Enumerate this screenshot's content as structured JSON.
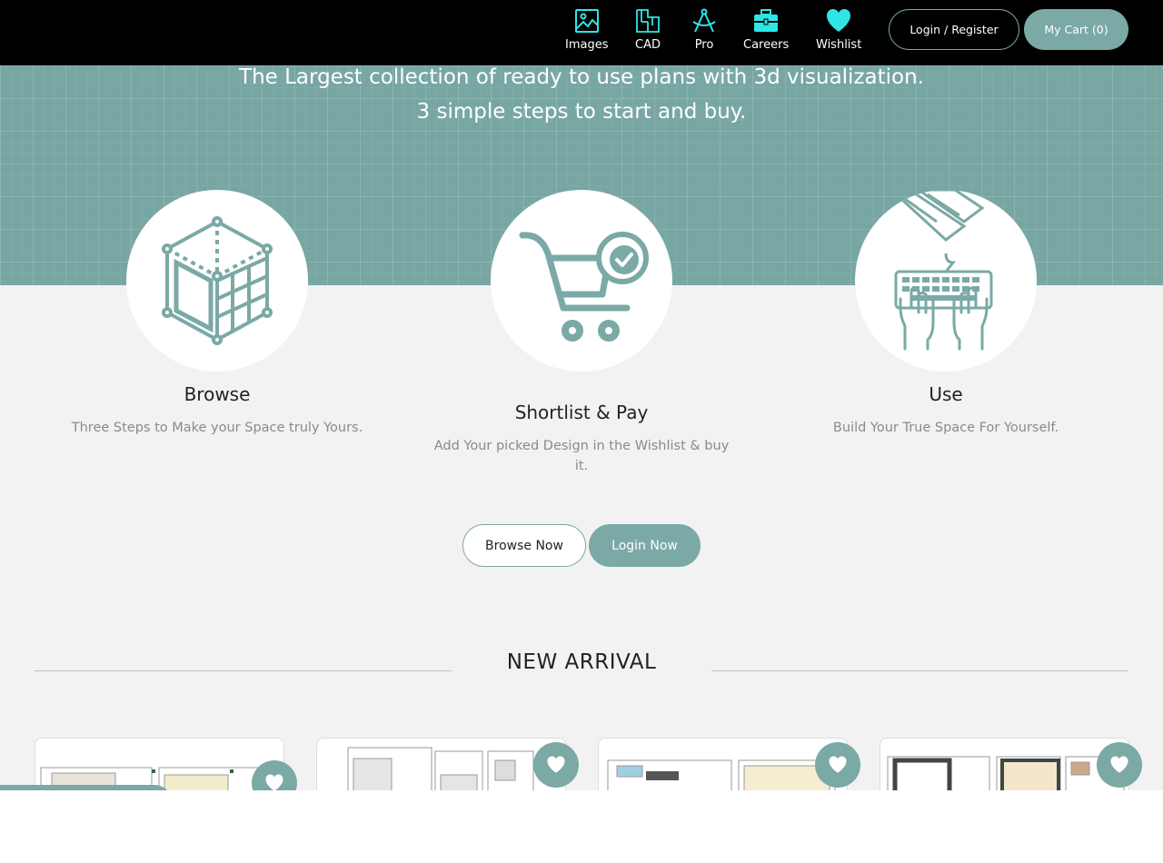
{
  "header": {
    "nav": [
      {
        "label": "Images",
        "icon": "image-icon"
      },
      {
        "label": "CAD",
        "icon": "cad-icon"
      },
      {
        "label": "Pro",
        "icon": "compass-icon"
      },
      {
        "label": "Careers",
        "icon": "briefcase-icon"
      },
      {
        "label": "Wishlist",
        "icon": "heart-icon"
      }
    ],
    "login_label": "Login / Register",
    "cart_label": "My Cart (0)"
  },
  "hero": {
    "line1": "The Largest collection of ready to use plans with 3d visualization.",
    "line2": "3 simple steps to start and buy."
  },
  "steps": [
    {
      "title": "Browse",
      "desc": "Three Steps to Make your Space truly Yours.",
      "icon": "cube-grid-icon"
    },
    {
      "title": "Shortlist & Pay",
      "desc_line1": "Add Your picked Design in the Wishlist & buy",
      "desc_line2": "it.",
      "icon": "cart-check-icon"
    },
    {
      "title": "Use",
      "desc": "Build Your True Space For Yourself.",
      "icon": "keyboard-hands-icon"
    }
  ],
  "actions": {
    "browse_now": "Browse Now",
    "login_now": "Login Now"
  },
  "new_arrival": {
    "title": "NEW ARRIVAL"
  },
  "colors": {
    "accent": "#7aa9a6",
    "nav_icon": "#2ee6e6",
    "header_bg": "#000000",
    "page_bg": "#f2f2f2"
  }
}
